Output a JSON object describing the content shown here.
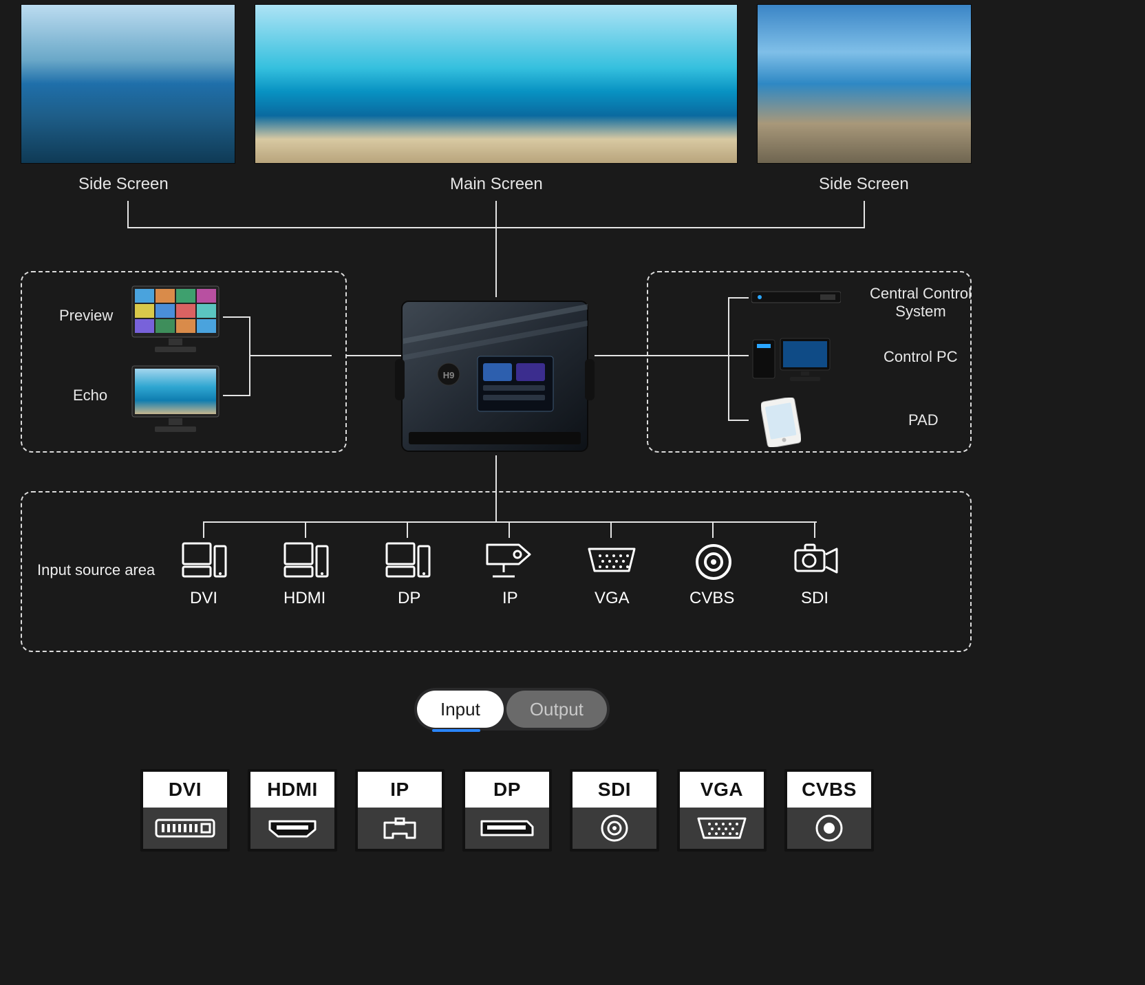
{
  "screens": {
    "left_label": "Side Screen",
    "main_label": "Main Screen",
    "right_label": "Side Screen"
  },
  "monitors_panel": {
    "preview_label": "Preview",
    "echo_label": "Echo"
  },
  "control_panel": {
    "ccs_label": "Central Control\nSystem",
    "pc_label": "Control PC",
    "pad_label": "PAD"
  },
  "inputs_area": {
    "title": "Input source area",
    "items": [
      "DVI",
      "HDMI",
      "DP",
      "IP",
      "VGA",
      "CVBS",
      "SDI"
    ]
  },
  "tabs": {
    "input": "Input",
    "output": "Output"
  },
  "io_cards": [
    "DVI",
    "HDMI",
    "IP",
    "DP",
    "SDI",
    "VGA",
    "CVBS"
  ]
}
